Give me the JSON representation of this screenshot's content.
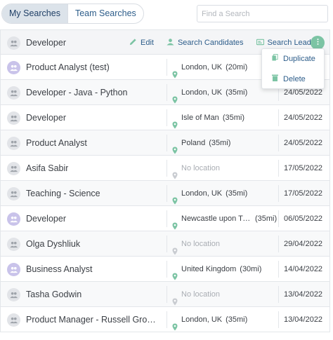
{
  "tabs": [
    {
      "label": "My Searches",
      "active": true
    },
    {
      "label": "Team Searches",
      "active": false
    }
  ],
  "search": {
    "placeholder": "Find a Search",
    "value": ""
  },
  "header_row": {
    "name": "Developer",
    "actions": [
      {
        "label": "Edit",
        "icon": "pencil-icon"
      },
      {
        "label": "Search Candidates",
        "icon": "candidates-icon"
      },
      {
        "label": "Search Leads",
        "icon": "leads-icon"
      }
    ],
    "more_icon": "more-vertical-icon"
  },
  "dropdown": {
    "items": [
      {
        "label": "Duplicate",
        "icon": "duplicate-icon"
      },
      {
        "label": "Delete",
        "icon": "trash-icon"
      }
    ]
  },
  "rows": [
    {
      "name": "Product Analyst (test)",
      "location": "London, UK",
      "radius": "(20mi)",
      "date": "",
      "team": true
    },
    {
      "name": "Developer - Java - Python",
      "location": "London, UK",
      "radius": "(35mi)",
      "date": "24/05/2022",
      "team": false
    },
    {
      "name": "Developer",
      "location": "Isle of Man",
      "radius": "(35mi)",
      "date": "24/05/2022",
      "team": false
    },
    {
      "name": "Product Analyst",
      "location": "Poland",
      "radius": "(35mi)",
      "date": "24/05/2022",
      "team": false
    },
    {
      "name": "Asifa Sabir",
      "location": "No location",
      "radius": "",
      "date": "17/05/2022",
      "team": false,
      "empty": true
    },
    {
      "name": "Teaching - Science",
      "location": "London, UK",
      "radius": "(35mi)",
      "date": "17/05/2022",
      "team": false
    },
    {
      "name": "Developer",
      "location": "Newcastle upon Tyne, UK",
      "radius": "(35mi)",
      "date": "06/05/2022",
      "team": true
    },
    {
      "name": "Olga Dyshliuk",
      "location": "No location",
      "radius": "",
      "date": "29/04/2022",
      "team": false,
      "empty": true
    },
    {
      "name": "Business Analyst",
      "location": "United Kingdom",
      "radius": "(30mi)",
      "date": "14/04/2022",
      "team": true
    },
    {
      "name": "Tasha Godwin",
      "location": "No location",
      "radius": "",
      "date": "13/04/2022",
      "team": false,
      "empty": true
    },
    {
      "name": "Product Manager - Russell Group University",
      "location": "London, UK",
      "radius": "(35mi)",
      "date": "13/04/2022",
      "team": false
    }
  ],
  "colors": {
    "accent": "#2d5d8a",
    "pin": "#7cc4a4",
    "team_avatar": "#c9c3ea",
    "user_avatar": "#e2e4e8"
  }
}
